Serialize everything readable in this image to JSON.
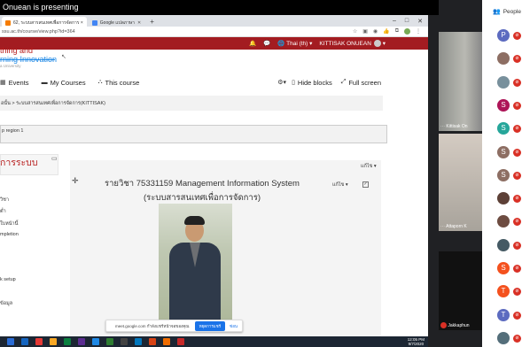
{
  "banner": {
    "text": "Onuean is presenting"
  },
  "browser": {
    "tabs": [
      {
        "label": "62, ระบบสารสนเทศเพื่อการจัดการ ×",
        "color": "#f57c00",
        "active": true
      },
      {
        "label": "Google แปลภาษา",
        "color": "#4285f4",
        "active": false
      }
    ],
    "new_tab": "+",
    "window_controls": [
      "–",
      "□",
      "✕"
    ],
    "url": "ssu.ac.th/course/view.php?id=364"
  },
  "moodle": {
    "topbar": {
      "language": "Thai (th)",
      "user": "KITTISAK ONUEAN"
    },
    "logo": {
      "line1": "thing and",
      "line2": "rning Innovation",
      "line3": "a University"
    },
    "nav": {
      "events": "Events",
      "my_courses": "My Courses",
      "this_course": "This course",
      "hide_blocks": "Hide blocks",
      "full_screen": "Full screen"
    },
    "breadcrumb": "อนั้น  >  ระบบสารสนเทศเพื่อการจัดการ(KITTISAK)",
    "region": "p region 1",
    "left": {
      "title": "การระบบ",
      "items": [
        "วิชา",
        "ต่ำ",
        "ใบหน้านี้",
        "mpletion",
        "k setup",
        "ข้อมูล"
      ]
    },
    "main": {
      "edit_top": "แก้ไข",
      "course_title": "รายวิชา 75331159 Management Information System",
      "course_subtitle": "(ระบบสารสนเทศเพื่อการจัดการ)",
      "edit_mid": "แก้ไข",
      "check": "✓"
    }
  },
  "share_bar": {
    "text": "meet.google.com กำลังแชร์หน้าจอของคุณ",
    "stop": "หยุดการแชร์",
    "hide": "ซ่อน"
  },
  "taskbar": {
    "time": "12:05 PM",
    "date": "9/7/2020",
    "icons": [
      "#2a6cd6",
      "#1565c0",
      "#e53935",
      "#f9a825",
      "#0a7f3f",
      "#5b2d91",
      "#1e88e5",
      "#2e7d32",
      "#424242",
      "#0277bd",
      "#d84315",
      "#ef6c00",
      "#c62828"
    ]
  },
  "videos": [
    {
      "name": "Kittisak On"
    },
    {
      "name": "Attaporn K"
    },
    {
      "name": "Jakkaphun"
    }
  ],
  "people": {
    "title": "People",
    "participants": [
      {
        "initial": "P",
        "color": "#5c6bc0"
      },
      {
        "initial": "",
        "color": "#8d6e63"
      },
      {
        "initial": "",
        "color": "#78909c"
      },
      {
        "initial": "S",
        "color": "#ad1457"
      },
      {
        "initial": "S",
        "color": "#26a69a"
      },
      {
        "initial": "S",
        "color": "#8d6e63"
      },
      {
        "initial": "S",
        "color": "#8d6e63"
      },
      {
        "initial": "",
        "color": "#5d4037"
      },
      {
        "initial": "",
        "color": "#6d4c41"
      },
      {
        "initial": "",
        "color": "#455a64"
      },
      {
        "initial": "S",
        "color": "#f4511e"
      },
      {
        "initial": "T",
        "color": "#f4511e"
      },
      {
        "initial": "T",
        "color": "#5c6bc0"
      },
      {
        "initial": "",
        "color": "#546e7a"
      }
    ]
  }
}
